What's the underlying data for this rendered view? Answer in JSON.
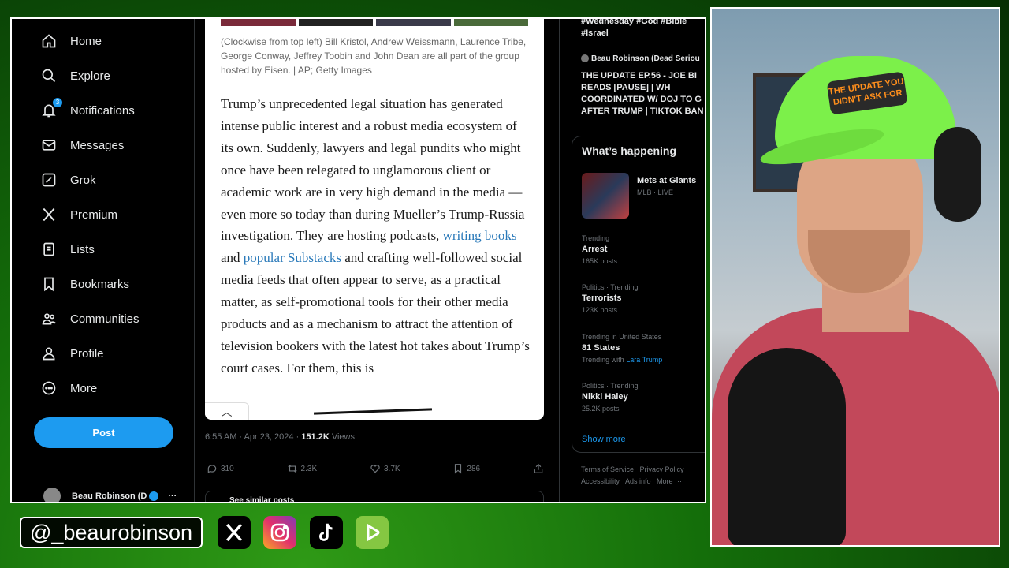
{
  "sidebar": {
    "items": [
      {
        "label": "Home",
        "icon": "home-icon"
      },
      {
        "label": "Explore",
        "icon": "search-icon"
      },
      {
        "label": "Notifications",
        "icon": "bell-icon",
        "badge": "3"
      },
      {
        "label": "Messages",
        "icon": "envelope-icon"
      },
      {
        "label": "Grok",
        "icon": "grok-icon"
      },
      {
        "label": "Premium",
        "icon": "x-logo-icon"
      },
      {
        "label": "Lists",
        "icon": "list-icon"
      },
      {
        "label": "Bookmarks",
        "icon": "bookmark-icon"
      },
      {
        "label": "Communities",
        "icon": "people-icon"
      },
      {
        "label": "Profile",
        "icon": "person-icon"
      },
      {
        "label": "More",
        "icon": "more-circle-icon"
      }
    ],
    "post_label": "Post",
    "account_name": "Beau Robinson (D",
    "account_more": "···"
  },
  "article": {
    "caption": "(Clockwise from top left) Bill Kristol, Andrew Weissmann, Laurence Tribe, George Conway, Jeffrey Toobin and John Dean are all part of the group hosted by Eisen. | AP; Getty Images",
    "text_before_links": "Trump’s unprecedented legal situation has generated intense public interest and a robust media ecosystem of its own. Suddenly, lawyers and legal pundits who might once have been relegated to unglamorous client or academic work are in very high demand in the media — even more so today than during Mueller’s Trump-Russia investigation. They are hosting podcasts, ",
    "link1": "writing books",
    "and_word": " and ",
    "link2": "popular Substacks",
    "text_after_links": " and crafting well-followed social media feeds that often appear to serve, as a practical matter, as self-promotional tools for their other media products and as a mechanism to attract the attention of television bookers with the latest hot takes about Trump’s court cases. For them, this is"
  },
  "tweet_meta": {
    "time": "6:55 AM · Apr 23, 2024 · ",
    "views_count": "151.2K",
    "views_label": " Views"
  },
  "actions": {
    "replies": "310",
    "reposts": "2.3K",
    "likes": "3.7K",
    "bookmarks": "286"
  },
  "similar_posts": "See similar posts",
  "right_column": {
    "hashtags": "#Wednesday #God #Bible #Israel",
    "channel": "Beau Robinson (Dead Seriou",
    "update_title": "THE UPDATE EP.56 - JOE BI\nREADS [PAUSE] | WH\nCOORDINATED W/ DOJ TO G\nAFTER TRUMP | TIKTOK BAN",
    "whats_happening": "What’s happening",
    "game_title": "Mets at Giants",
    "game_sub": "MLB · LIVE",
    "trends": [
      {
        "ctx": "Trending",
        "name": "Arrest",
        "count": "165K posts"
      },
      {
        "ctx": "Politics · Trending",
        "name": "Terrorists",
        "count": "123K posts"
      },
      {
        "ctx": "Trending in United States",
        "name": "81 States",
        "count": "Trending with",
        "count_link": "Lara Trump"
      },
      {
        "ctx": "Politics · Trending",
        "name": "Nikki Haley",
        "count": "25.2K posts"
      }
    ],
    "show_more": "Show more",
    "footer_line1": "Terms of Service   Privacy Policy",
    "footer_line2": "Accessibility   Ads info   More ···"
  },
  "webcam": {
    "cap_text": "THE UPDATE YOU DIDN'T ASK FOR"
  },
  "overlay": {
    "handle": "@_beaurobinson",
    "socials": [
      "x-logo-icon",
      "instagram-icon",
      "tiktok-icon",
      "rumble-icon"
    ],
    "colors": {
      "x": "#000000",
      "instagram": "#e1306c",
      "tiktok": "#000000",
      "rumble": "#85c742",
      "accent": "#1d9bf0"
    }
  }
}
